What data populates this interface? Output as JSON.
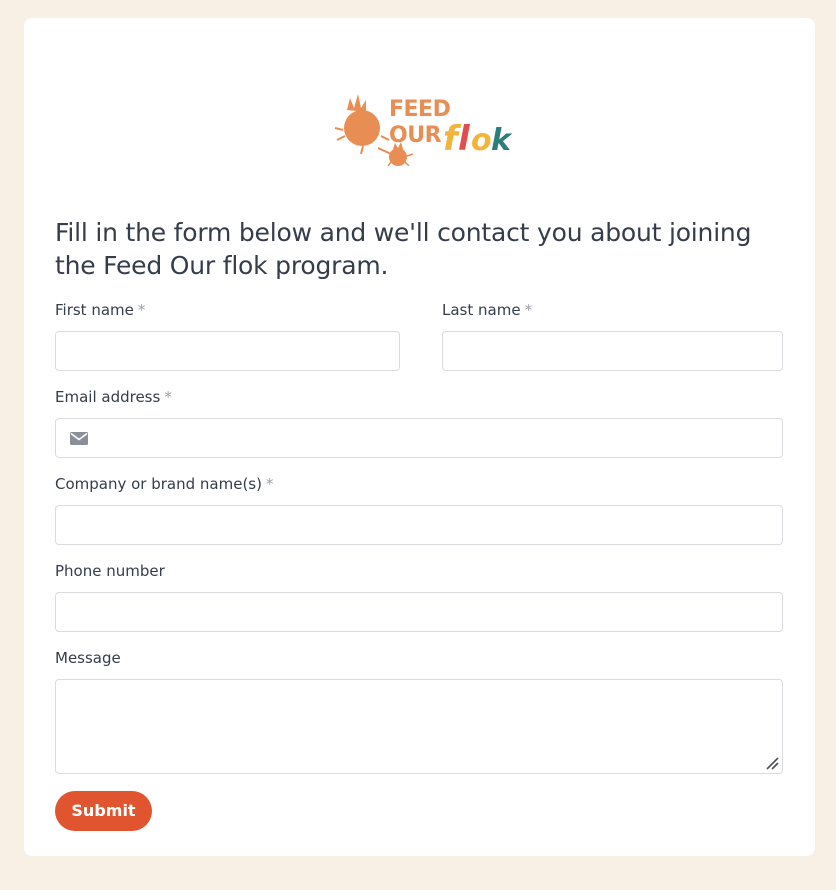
{
  "logo": {
    "alt_text": "FEED OUR flok",
    "colors": {
      "orange": "#e88e55",
      "yellow": "#f2b43a",
      "red": "#e04e4e",
      "teal": "#2d7d78"
    }
  },
  "form": {
    "headline": "Fill in the form below and we'll contact you about joining the Feed Our flok program.",
    "required_marker": "*",
    "fields": {
      "first_name": {
        "label": "First name",
        "required": true,
        "value": ""
      },
      "last_name": {
        "label": "Last name",
        "required": true,
        "value": ""
      },
      "email": {
        "label": "Email address",
        "required": true,
        "value": "",
        "icon": "envelope-icon"
      },
      "company": {
        "label": "Company or brand name(s)",
        "required": true,
        "value": ""
      },
      "phone": {
        "label": "Phone number",
        "required": false,
        "value": ""
      },
      "message": {
        "label": "Message",
        "required": false,
        "value": ""
      }
    },
    "submit_label": "Submit"
  },
  "colors": {
    "page_background": "#f8f0e5",
    "card_background": "#ffffff",
    "text": "#353c4a",
    "accent": "#e05530",
    "input_border": "#d9dbdf"
  }
}
